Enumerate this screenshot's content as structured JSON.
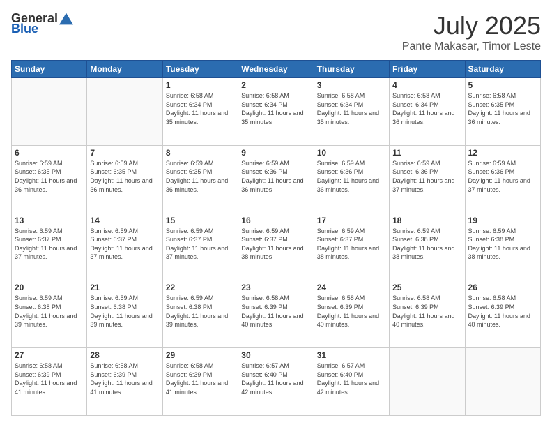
{
  "header": {
    "logo_general": "General",
    "logo_blue": "Blue",
    "month": "July 2025",
    "location": "Pante Makasar, Timor Leste"
  },
  "weekdays": [
    "Sunday",
    "Monday",
    "Tuesday",
    "Wednesday",
    "Thursday",
    "Friday",
    "Saturday"
  ],
  "weeks": [
    [
      {
        "day": "",
        "info": ""
      },
      {
        "day": "",
        "info": ""
      },
      {
        "day": "1",
        "info": "Sunrise: 6:58 AM\nSunset: 6:34 PM\nDaylight: 11 hours and 35 minutes."
      },
      {
        "day": "2",
        "info": "Sunrise: 6:58 AM\nSunset: 6:34 PM\nDaylight: 11 hours and 35 minutes."
      },
      {
        "day": "3",
        "info": "Sunrise: 6:58 AM\nSunset: 6:34 PM\nDaylight: 11 hours and 35 minutes."
      },
      {
        "day": "4",
        "info": "Sunrise: 6:58 AM\nSunset: 6:34 PM\nDaylight: 11 hours and 36 minutes."
      },
      {
        "day": "5",
        "info": "Sunrise: 6:58 AM\nSunset: 6:35 PM\nDaylight: 11 hours and 36 minutes."
      }
    ],
    [
      {
        "day": "6",
        "info": "Sunrise: 6:59 AM\nSunset: 6:35 PM\nDaylight: 11 hours and 36 minutes."
      },
      {
        "day": "7",
        "info": "Sunrise: 6:59 AM\nSunset: 6:35 PM\nDaylight: 11 hours and 36 minutes."
      },
      {
        "day": "8",
        "info": "Sunrise: 6:59 AM\nSunset: 6:35 PM\nDaylight: 11 hours and 36 minutes."
      },
      {
        "day": "9",
        "info": "Sunrise: 6:59 AM\nSunset: 6:36 PM\nDaylight: 11 hours and 36 minutes."
      },
      {
        "day": "10",
        "info": "Sunrise: 6:59 AM\nSunset: 6:36 PM\nDaylight: 11 hours and 36 minutes."
      },
      {
        "day": "11",
        "info": "Sunrise: 6:59 AM\nSunset: 6:36 PM\nDaylight: 11 hours and 37 minutes."
      },
      {
        "day": "12",
        "info": "Sunrise: 6:59 AM\nSunset: 6:36 PM\nDaylight: 11 hours and 37 minutes."
      }
    ],
    [
      {
        "day": "13",
        "info": "Sunrise: 6:59 AM\nSunset: 6:37 PM\nDaylight: 11 hours and 37 minutes."
      },
      {
        "day": "14",
        "info": "Sunrise: 6:59 AM\nSunset: 6:37 PM\nDaylight: 11 hours and 37 minutes."
      },
      {
        "day": "15",
        "info": "Sunrise: 6:59 AM\nSunset: 6:37 PM\nDaylight: 11 hours and 37 minutes."
      },
      {
        "day": "16",
        "info": "Sunrise: 6:59 AM\nSunset: 6:37 PM\nDaylight: 11 hours and 38 minutes."
      },
      {
        "day": "17",
        "info": "Sunrise: 6:59 AM\nSunset: 6:37 PM\nDaylight: 11 hours and 38 minutes."
      },
      {
        "day": "18",
        "info": "Sunrise: 6:59 AM\nSunset: 6:38 PM\nDaylight: 11 hours and 38 minutes."
      },
      {
        "day": "19",
        "info": "Sunrise: 6:59 AM\nSunset: 6:38 PM\nDaylight: 11 hours and 38 minutes."
      }
    ],
    [
      {
        "day": "20",
        "info": "Sunrise: 6:59 AM\nSunset: 6:38 PM\nDaylight: 11 hours and 39 minutes."
      },
      {
        "day": "21",
        "info": "Sunrise: 6:59 AM\nSunset: 6:38 PM\nDaylight: 11 hours and 39 minutes."
      },
      {
        "day": "22",
        "info": "Sunrise: 6:59 AM\nSunset: 6:38 PM\nDaylight: 11 hours and 39 minutes."
      },
      {
        "day": "23",
        "info": "Sunrise: 6:58 AM\nSunset: 6:39 PM\nDaylight: 11 hours and 40 minutes."
      },
      {
        "day": "24",
        "info": "Sunrise: 6:58 AM\nSunset: 6:39 PM\nDaylight: 11 hours and 40 minutes."
      },
      {
        "day": "25",
        "info": "Sunrise: 6:58 AM\nSunset: 6:39 PM\nDaylight: 11 hours and 40 minutes."
      },
      {
        "day": "26",
        "info": "Sunrise: 6:58 AM\nSunset: 6:39 PM\nDaylight: 11 hours and 40 minutes."
      }
    ],
    [
      {
        "day": "27",
        "info": "Sunrise: 6:58 AM\nSunset: 6:39 PM\nDaylight: 11 hours and 41 minutes."
      },
      {
        "day": "28",
        "info": "Sunrise: 6:58 AM\nSunset: 6:39 PM\nDaylight: 11 hours and 41 minutes."
      },
      {
        "day": "29",
        "info": "Sunrise: 6:58 AM\nSunset: 6:39 PM\nDaylight: 11 hours and 41 minutes."
      },
      {
        "day": "30",
        "info": "Sunrise: 6:57 AM\nSunset: 6:40 PM\nDaylight: 11 hours and 42 minutes."
      },
      {
        "day": "31",
        "info": "Sunrise: 6:57 AM\nSunset: 6:40 PM\nDaylight: 11 hours and 42 minutes."
      },
      {
        "day": "",
        "info": ""
      },
      {
        "day": "",
        "info": ""
      }
    ]
  ]
}
